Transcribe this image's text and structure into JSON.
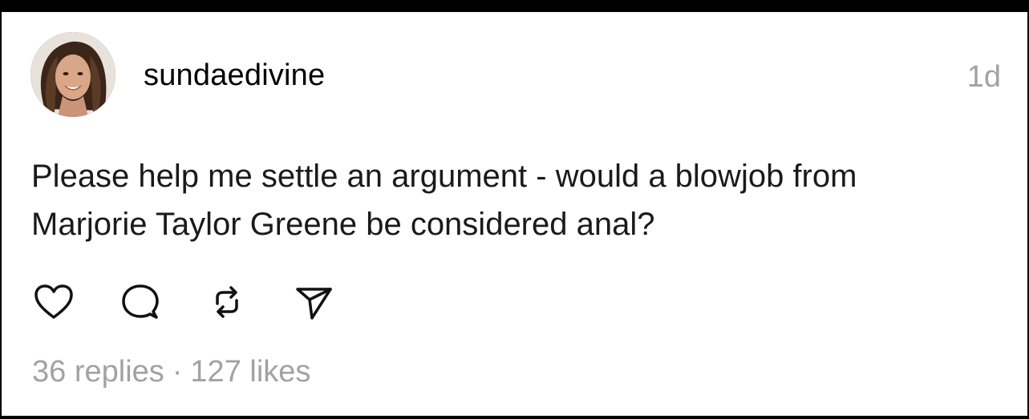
{
  "post": {
    "username": "sundaedivine",
    "timestamp": "1d",
    "text_lines": [
      "Please help me settle an argument - would a blowjob from",
      "Marjorie Taylor Greene be considered anal?"
    ],
    "replies": "36 replies",
    "separator": "·",
    "likes": "127 likes"
  },
  "icons": {
    "avatar": "avatar-photo",
    "like": "heart-icon",
    "reply": "comment-bubble-icon",
    "repost": "repost-icon",
    "share": "send-icon"
  },
  "colors": {
    "text": "#1a1a1a",
    "muted": "#a2a2a2",
    "background": "#ffffff",
    "frame": "#000000"
  }
}
